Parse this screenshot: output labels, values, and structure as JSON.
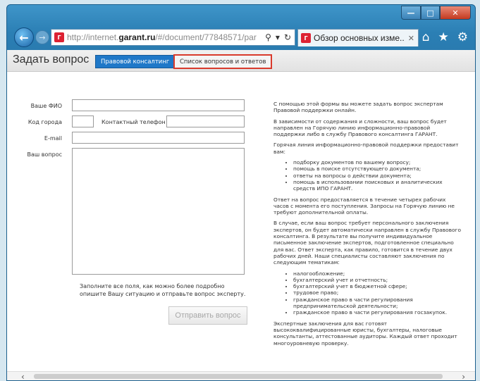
{
  "browser": {
    "url_prefix": "http://internet.",
    "url_domain": "garant.ru",
    "url_suffix": "/#/document/77848571/par",
    "tab_title": "Обзор основных изме...",
    "search_glyph": "⚲",
    "refresh_glyph": "↻",
    "dropdown_glyph": "▾",
    "tab_close_glyph": "✕",
    "back_glyph": "←",
    "forward_glyph": "→",
    "home_glyph": "⌂",
    "star_glyph": "★",
    "gear_glyph": "⚙",
    "minimize_glyph": "—",
    "maximize_glyph": "□",
    "close_glyph": "✕",
    "favicon_text": "Г"
  },
  "header": {
    "title": "Задать вопрос",
    "btn_consult": "Правовой консалтинг",
    "btn_list": "Список вопросов и ответов"
  },
  "form": {
    "fio_label": "Ваше ФИО",
    "city_code_label": "Код города",
    "phone_label": "Контактный телефон",
    "email_label": "E-mail",
    "question_label": "Ваш вопрос",
    "hint": "Заполните все поля, как можно более подробно опишите Вашу ситуацию и отправьте вопрос эксперту.",
    "submit": "Отправить вопрос"
  },
  "info": {
    "p1": "С помощью этой формы вы можете задать вопрос экспертам Правовой поддержки онлайн.",
    "p2": "В зависимости от содержания и сложности, ваш вопрос будет направлен на Горячую линию информационно-правовой поддержки либо в службу Правового консалтинга ГАРАНТ.",
    "p3": "Горячая линия информационно-правовой поддержки предоставит вам:",
    "list1": [
      "подборку документов по вашему вопросу;",
      "помощь в поиске отсутствующего документа;",
      "ответы на вопросы о действии документа;",
      "помощь в использовании поисковых и аналитических средств ИПО ГАРАНТ."
    ],
    "p4": "Ответ на вопрос предоставляется в течение четырех рабочих часов с момента его поступления. Запросы на Горячую линию не требуют дополнительной оплаты.",
    "p5": "В случае, если ваш вопрос требует персонального заключения экспертов, он будет автоматически направлен в службу Правового консалтинга. В результате вы получите индивидуальное письменное заключение экспертов, подготовленное специально для вас. Ответ эксперта, как правило, готовится в течение двух рабочих дней. Наши специалисты составляют заключения по следующим тематикам:",
    "list2": [
      "налогообложение;",
      "бухгалтерский учет и отчетность;",
      "бухгалтерский учет в бюджетной сфере;",
      "трудовое право;",
      "гражданское право в части регулирования предпринимательской деятельности;",
      "гражданское право в части регулирования госзакупок."
    ],
    "p6": "Экспертные заключения для вас готовят высококвалифицированные юристы, бухгалтеры, налоговые консультанты, аттестованные аудиторы. Каждый ответ проходит многоуровневую проверку."
  },
  "scroll": {
    "left_glyph": "‹",
    "right_glyph": "›"
  }
}
